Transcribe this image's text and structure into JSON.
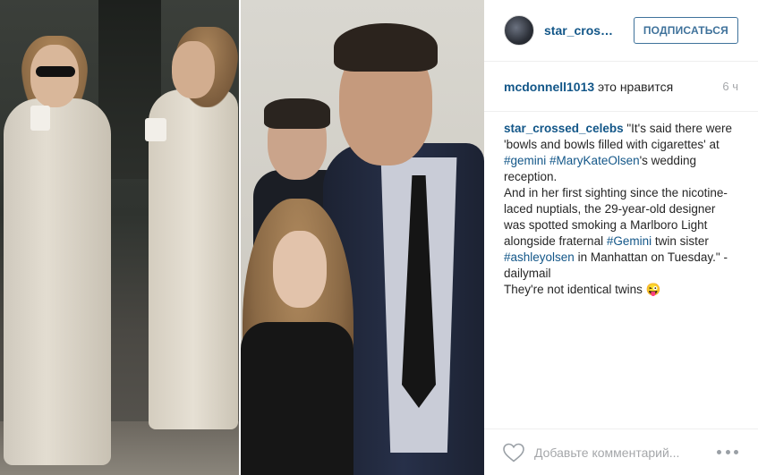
{
  "post": {
    "header": {
      "username": "star_crossed_celebs",
      "follow_label": "ПОДПИСАТЬСЯ"
    },
    "likes": {
      "liker": "mcdonnell1013",
      "likes_text": "это нравится",
      "time": "6 ч"
    },
    "caption": {
      "author": "star_crossed_celebs",
      "seg1": "\"It's said there were 'bowls and bowls filled with cigarettes' at ",
      "tag1": "#gemini",
      "seg2": " ",
      "tag2": "#MaryKateOlsen",
      "seg3": "'s wedding reception.",
      "para2_seg1": "And in her first sighting since the nicotine-laced nuptials, the 29-year-old designer was spotted smoking a Marlboro Light alongside fraternal ",
      "tag3": "#Gemini",
      "para2_seg2": " twin sister ",
      "tag4": "#ashleyolsen",
      "para2_seg3": " in Manhattan on Tuesday.\" - dailymail",
      "para3": "They're not identical twins 😜"
    },
    "comment": {
      "placeholder": "Добавьте комментарий..."
    },
    "icons": {
      "like": "heart-icon",
      "more": "more-icon"
    },
    "colors": {
      "link": "#125688",
      "follow_border": "#3f729b",
      "muted": "#a5a7aa"
    }
  }
}
